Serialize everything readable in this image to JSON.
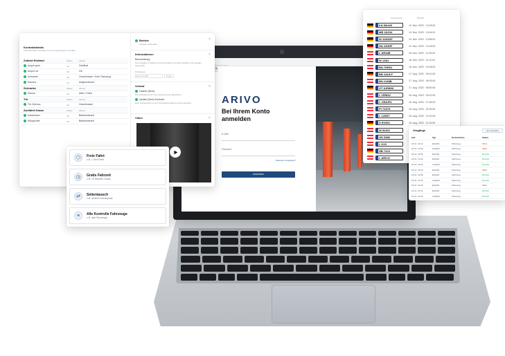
{
  "detail": {
    "header_title": "Kontraktdetails",
    "header_sub": "Übersicht aller Kontrakte und der zugehörigen Kontrakte",
    "sections": [
      {
        "title": "Zufahrt Einfahrt",
        "cols": [
          "Status",
          "Aktuell"
        ],
        "rows": [
          {
            "name": "Ampel grün",
            "status": "OK",
            "value": "Geöffnet"
          },
          {
            "name": "Ampel rot",
            "status": "OK",
            "value": "OK"
          },
          {
            "name": "Schranke",
            "status": "OK",
            "value": "Geschlossen / Kein Fahrzeug"
          },
          {
            "name": "Kamera",
            "status": "OK",
            "value": "Aufgezeichnet"
          }
        ]
      },
      {
        "title": "Schranke",
        "cols": [
          "Status",
          "Aktuell"
        ],
        "rows": [
          {
            "name": "Sensor",
            "status": "OK",
            "value": "Aktiv / Keine"
          }
        ]
      },
      {
        "title": "Tür",
        "cols": [
          "Status",
          "Aktuell"
        ],
        "rows": [
          {
            "name": "Tür Schloss",
            "status": "OK",
            "value": "Geschlossen"
          }
        ]
      },
      {
        "title": "Ausfahrt Kasse",
        "cols": [
          "Status",
          "Aktuell"
        ],
        "rows": [
          {
            "name": "Kartenleser",
            "status": "OK",
            "value": "Betriebsbereit"
          },
          {
            "name": "Münzprüfer",
            "status": "OK",
            "value": "Betriebsbereit"
          }
        ]
      }
    ],
    "right": {
      "status_title": "Betrieb",
      "status_sub": "Anlagen verbunden",
      "info_title": "Informationen",
      "info_label": "Beschreibung",
      "info_text": "Die Ausgabe im Betrieb wird automatisch bei allen Geräten und Anlagen überwacht.",
      "date_label": "IP Adresse",
      "date_value": "10.44.12.156",
      "date_btn": "Kopie",
      "history_title": "Verlauf",
      "history": [
        {
          "title": "Gestört (Wort)",
          "text": "Die Softwareversion des Geräts wurde aktualisiert."
        },
        {
          "title": "Update (Wort) Kontrakt",
          "text": "Eine Konfiguration in der Kontraktverwaltung wurde geändert."
        }
      ],
      "video_title": "Video"
    }
  },
  "actions": [
    {
      "title": "Freie Fahrt",
      "sub": "z.B. 1 Zeit Fahrt",
      "icon": "car-icon"
    },
    {
      "title": "Gratis Fahrzeit",
      "sub": "z.B. 15 Minuten Gratis",
      "icon": "clock-icon"
    },
    {
      "title": "Seitentausch",
      "sub": "z.B. anderer Kartenplatz",
      "icon": "swap-icon"
    },
    {
      "title": "Alle Kontrolle Fahrzeuge",
      "sub": "z.B. alle Fahrzeuge",
      "icon": "list-icon"
    }
  ],
  "login": {
    "tab_label": "Sprache",
    "logo": "ARIVO",
    "heading_line1": "Bei Ihrem Konto",
    "heading_line2": "anmelden",
    "email_label": "E-Mail",
    "password_label": "Passwort",
    "forgot": "Passwort vergessen?",
    "submit": "Anmelden"
  },
  "plates": {
    "col1": "Kennzeichen",
    "col2": "Einfahrt",
    "rows": [
      {
        "flag": "de",
        "plate": "KA NK420",
        "date": "19. Nov. 2023 · 13:18:00"
      },
      {
        "flag": "de",
        "plate": "MB 1NZ34",
        "date": "19. Nov. 2023 · 13:04:00"
      },
      {
        "flag": "de",
        "plate": "W 41N3DF",
        "date": "19. Nov. 2023 · 12:56:00"
      },
      {
        "flag": "de",
        "plate": "HA 22HHF",
        "date": "19. Nov. 2023 · 12:45:00"
      },
      {
        "flag": "at",
        "plate": "L AR44B",
        "date": "18. Nov. 2023 · 11:30:00"
      },
      {
        "flag": "at",
        "plate": "W 12N1",
        "date": "18. Nov. 2023 · 11:12:00"
      },
      {
        "flag": "at",
        "plate": "BN 7HR02",
        "date": "18. Nov. 2023 · 10:05:00"
      },
      {
        "flag": "de",
        "plate": "BB 2AHLP",
        "date": "17. Aug. 2023 · 09:10:00"
      },
      {
        "flag": "at",
        "plate": "BN 2188B",
        "date": "17. Aug. 2023 · 09:03:00"
      },
      {
        "flag": "de",
        "plate": "GT 8JR8H6",
        "date": "17. Aug. 2023 · 08:50:00"
      },
      {
        "flag": "at",
        "plate": "L 1FBDU",
        "date": "16. Aug. 2023 · 18:12:00"
      },
      {
        "flag": "at",
        "plate": "L 23NUF4",
        "date": "16. Aug. 2023 · 17:45:00"
      },
      {
        "flag": "at",
        "plate": "PI 72S76",
        "date": "16. Aug. 2023 · 15:30:00"
      },
      {
        "flag": "at",
        "plate": "L 12SET",
        "date": "15. Aug. 2023 · 12:22:00"
      },
      {
        "flag": "de",
        "plate": "S RV551",
        "date": "15. Aug. 2023 · 11:10:00"
      },
      {
        "flag": "at",
        "plate": "W 52401",
        "date": "14. Aug. 2023 · 10:05:00"
      },
      {
        "flag": "at",
        "plate": "GD 5386",
        "date": "14. Aug. 2023 · 09:40:00"
      },
      {
        "flag": "at",
        "plate": "L K15",
        "date": "13. Aug. 2023 · 09:00:00"
      },
      {
        "flag": "de",
        "plate": "HB 7423",
        "date": "13. Aug. 2023 · 08:12:00"
      },
      {
        "flag": "at",
        "plate": "L ARIVO",
        "date": "12. Aug. 2023 · 07:55:00"
      }
    ]
  },
  "table": {
    "title": "Vorgänge",
    "button": "Herunterladen",
    "cols": [
      "Zeit",
      "Typ",
      "Kennzeichen",
      "Status"
    ],
    "rows": [
      {
        "time": "16.11. 14:12",
        "type": "Einfahrt",
        "plate": "Fahrzeug",
        "status": "Offen"
      },
      {
        "time": "16.11. 14:08",
        "type": "Ausfahrt",
        "plate": "Fahrzeug",
        "status": "Offen"
      },
      {
        "time": "16.11. 13:55",
        "type": "Einfahrt",
        "plate": "Fahrzeug",
        "status": "Bezahlt"
      },
      {
        "time": "16.11. 13:40",
        "type": "Einfahrt",
        "plate": "Fahrzeug",
        "status": "Bezahlt"
      },
      {
        "time": "16.11. 13:22",
        "type": "Ausfahrt",
        "plate": "Fahrzeug",
        "status": "Bezahlt"
      },
      {
        "time": "16.11. 13:10",
        "type": "Einfahrt",
        "plate": "Fahrzeug",
        "status": "Offen"
      },
      {
        "time": "16.11. 12:58",
        "type": "Einfahrt",
        "plate": "Fahrzeug",
        "status": "Bezahlt"
      },
      {
        "time": "16.11. 12:41",
        "type": "Ausfahrt",
        "plate": "Fahrzeug",
        "status": "Bezahlt"
      },
      {
        "time": "16.11. 12:30",
        "type": "Einfahrt",
        "plate": "Fahrzeug",
        "status": "Offen"
      },
      {
        "time": "16.11. 12:15",
        "type": "Einfahrt",
        "plate": "Fahrzeug",
        "status": "Bezahlt"
      },
      {
        "time": "16.11. 12:02",
        "type": "Ausfahrt",
        "plate": "Fahrzeug",
        "status": "Bezahlt"
      }
    ]
  },
  "colors": {
    "brand": "#1f3d6b",
    "accent": "#1f4a7a",
    "status_ok": "#2bb673"
  }
}
